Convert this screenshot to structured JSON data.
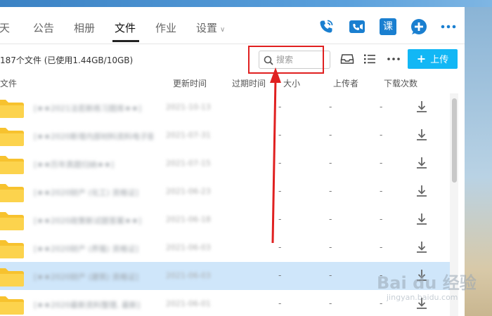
{
  "nav": {
    "tabs": [
      {
        "label": "聊天",
        "active": false
      },
      {
        "label": "公告",
        "active": false
      },
      {
        "label": "相册",
        "active": false
      },
      {
        "label": "文件",
        "active": true
      },
      {
        "label": "作业",
        "active": false
      },
      {
        "label": "设置",
        "active": false
      }
    ],
    "tab_visible_fragment_0": "聊天",
    "icons": [
      "phone-icon",
      "video-call-icon",
      "class-icon",
      "add-circle-icon",
      "more-icon"
    ],
    "class_icon_glyph": "课"
  },
  "toolbar": {
    "file_summary": "187个文件 (已使用1.44GB/10GB)",
    "search_placeholder": "搜索",
    "upload_label": "上传",
    "icons": [
      "inbox-icon",
      "list-view-icon",
      "more-icon"
    ]
  },
  "table": {
    "columns": [
      "文件",
      "更新时间",
      "过期时间",
      "大小",
      "上传者",
      "下载次数"
    ],
    "rows": [
      {
        "name": "[★★2021法若新练习题库★★]",
        "date": "2021-10-13",
        "expire": "-",
        "size": "-",
        "uploader": "-",
        "selected": false
      },
      {
        "name": "[★★2020新增内部材料资料电子版★★]",
        "date": "2021-07-31",
        "expire": "-",
        "size": "-",
        "uploader": "-",
        "selected": false
      },
      {
        "name": "[★★历年真题归纳★★]",
        "date": "2021-07-15",
        "expire": "-",
        "size": "-",
        "uploader": "-",
        "selected": false
      },
      {
        "name": "[★★2020财产 (化工) 资格证]",
        "date": "2021-06-23",
        "expire": "-",
        "size": "-",
        "uploader": "-",
        "selected": false
      },
      {
        "name": "[★★2020政策新试题答案★★]",
        "date": "2021-06-18",
        "expire": "-",
        "size": "-",
        "uploader": "-",
        "selected": false
      },
      {
        "name": "[★★2020财产 (养殖) 资格证]",
        "date": "2021-06-03",
        "expire": "-",
        "size": "-",
        "uploader": "-",
        "selected": false
      },
      {
        "name": "[★★2020财产 (建筑) 资格证]",
        "date": "2021-06-03",
        "expire": "-",
        "size": "-",
        "uploader": "-",
        "selected": true
      },
      {
        "name": "[★★2020最新资料整理, 最新]",
        "date": "2021-06-01",
        "expire": "-",
        "size": "-",
        "uploader": "-",
        "selected": false
      }
    ]
  },
  "colors": {
    "accent": "#12b7f5",
    "nav_icon": "#1a7fd0",
    "folder": "#f7c22e",
    "highlight": "#e02020",
    "selected_row": "#cfe6fa"
  },
  "watermark": {
    "main": "Bai du 经验",
    "sub": "jingyan.baidu.com"
  }
}
